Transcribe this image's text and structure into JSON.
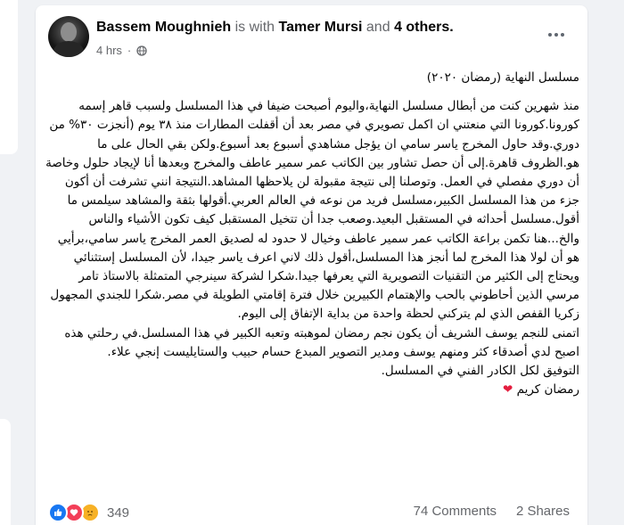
{
  "post": {
    "author": "Bassem Moughnieh",
    "with_text": "is with",
    "tagged_person": "Tamer Mursi",
    "and_text": "and",
    "others": "4 others.",
    "time": "4 hrs",
    "dot": "·",
    "body": {
      "title": "مسلسل النهاية (رمضان ٢٠٢٠)",
      "main": "منذ شهرين كنت من أبطال مسلسل النهاية،واليوم أصبحت ضيفا في هذا المسلسل ولسبب قاهر إسمه كورونا.كورونا التي منعتني ان اكمل تصويري في مصر بعد أن أقفلت المطارات منذ ٣٨ يوم (أنجزت ٣٠% من دوري.وقد حاول المخرج ياسر سامي ان يؤجل مشاهدي أسبوع بعد أسبوع.ولكن بقي الحال على ما هو.الظروف قاهرة.إلى أن حصل تشاور بين الكاتب عمر سمير عاطف والمخرج وبعدها أنا  لإيجاد حلول وخاصة أن دوري مفصلي في العمل. وتوصلنا إلى نتيجة مقبولة لن يلاحظها المشاهد.النتيجة انني تشرفت أن أكون جزء من هذا المسلسل الكبير،مسلسل فريد من نوعه في العالم العربي.أقولها بثقة والمشاهد سيلمس ما أقول.مسلسل أحداثه في المستقبل البعيد.وصعب جدا أن تتخيل المستقبل كيف تكون الأشياء والناس والخ...هنا تكمن براعة الكاتب عمر سمير عاطف وخيال لا حدود له لصديق العمر  المخرج ياسر سامي،برأيي هو أن لولا هذا المخرج لما أنجز هذا المسلسل،أقول ذلك لاني اعرف ياسر جيدا، لأن المسلسل إستثنائي ويحتاج إلى الكثير من التقنيات التصويرية التي يعرفها جيدا.شكرا لشركة سينرجي المتمثلة بالاستاذ تامر مرسي الذين أحاطوني بالحب والإهتمام الكبيرين  خلال فترة إقامتي الطويلة في مصر.شكرا للجندي المجهول زكريا القفص الذي لم يتركني لحظة واحدة من بداية الإتفاق إلى اليوم.\nاتمنى للنجم يوسف الشريف أن يكون نجم رمضان لموهبته وتعبه الكبير في هذا المسلسل.في رحلتي هذه اصبح لدي أصدقاء كثر ومنهم يوسف ومدير التصوير المبدع حسام حبيب والستايليست إنجي علاء.\nالتوفيق لكل الكادر الفني في المسلسل.",
      "closing": "رمضان كريم",
      "heart": "❤"
    },
    "reactions": {
      "count": "349",
      "icons": [
        "like-icon",
        "love-icon",
        "sad-icon"
      ]
    },
    "comments": "74 Comments",
    "shares": "2 Shares"
  },
  "colors": {
    "background": "#f0f2f5",
    "card": "#ffffff",
    "secondary_text": "#65676b",
    "like": "#1877f2",
    "love": "#f33e58",
    "sad": "#f7b125"
  }
}
